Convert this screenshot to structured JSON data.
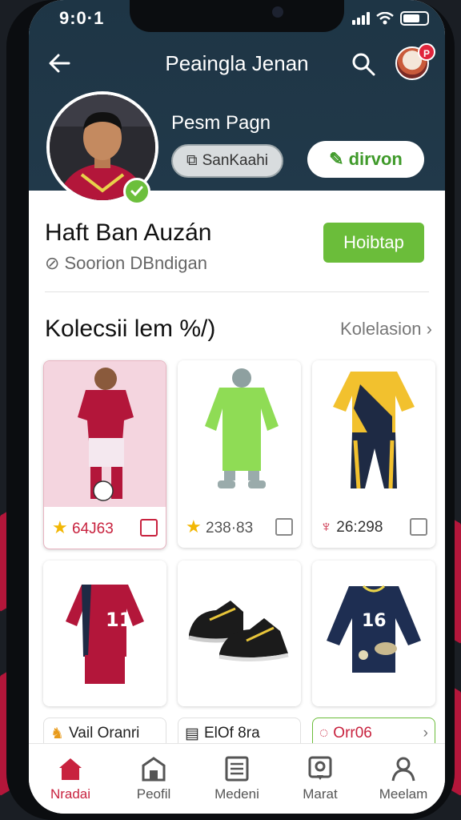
{
  "status": {
    "time": "9:0·1"
  },
  "header": {
    "title": "Peaingla Jenan",
    "profile_name": "Pesm Pagn",
    "chip_gray": "SanKaahi",
    "chip_white": "dirvon",
    "badge": "P"
  },
  "profile": {
    "name": "Haft Ban Auzán",
    "subtitle": "Soorion DBndigan",
    "action_button": "Hoibtap"
  },
  "collection": {
    "title": "Kolecsii lem %/)",
    "link": "Kolelasion",
    "cards": [
      {
        "rating": "64J63",
        "name": "red-jersey-player"
      },
      {
        "rating": "238·83",
        "name": "green-kit"
      },
      {
        "rating": "26:298",
        "name": "yellow-navy-kit"
      },
      {
        "name": "red-kit-11"
      },
      {
        "name": "black-boots"
      },
      {
        "name": "navy-jersey-16"
      }
    ],
    "partial_cards": [
      "Vail Oranri",
      "ElOf 8ra",
      "Orr06"
    ]
  },
  "nav": {
    "items": [
      {
        "label": "Nradai",
        "icon": "home-icon"
      },
      {
        "label": "Peofil",
        "icon": "shop-icon"
      },
      {
        "label": "Medeni",
        "icon": "list-icon"
      },
      {
        "label": "Marat",
        "icon": "map-pin-icon"
      },
      {
        "label": "Meelam",
        "icon": "user-icon"
      }
    ]
  },
  "colors": {
    "header": "#21394a",
    "accent_red": "#c8223e",
    "accent_green": "#6bbd3a"
  }
}
